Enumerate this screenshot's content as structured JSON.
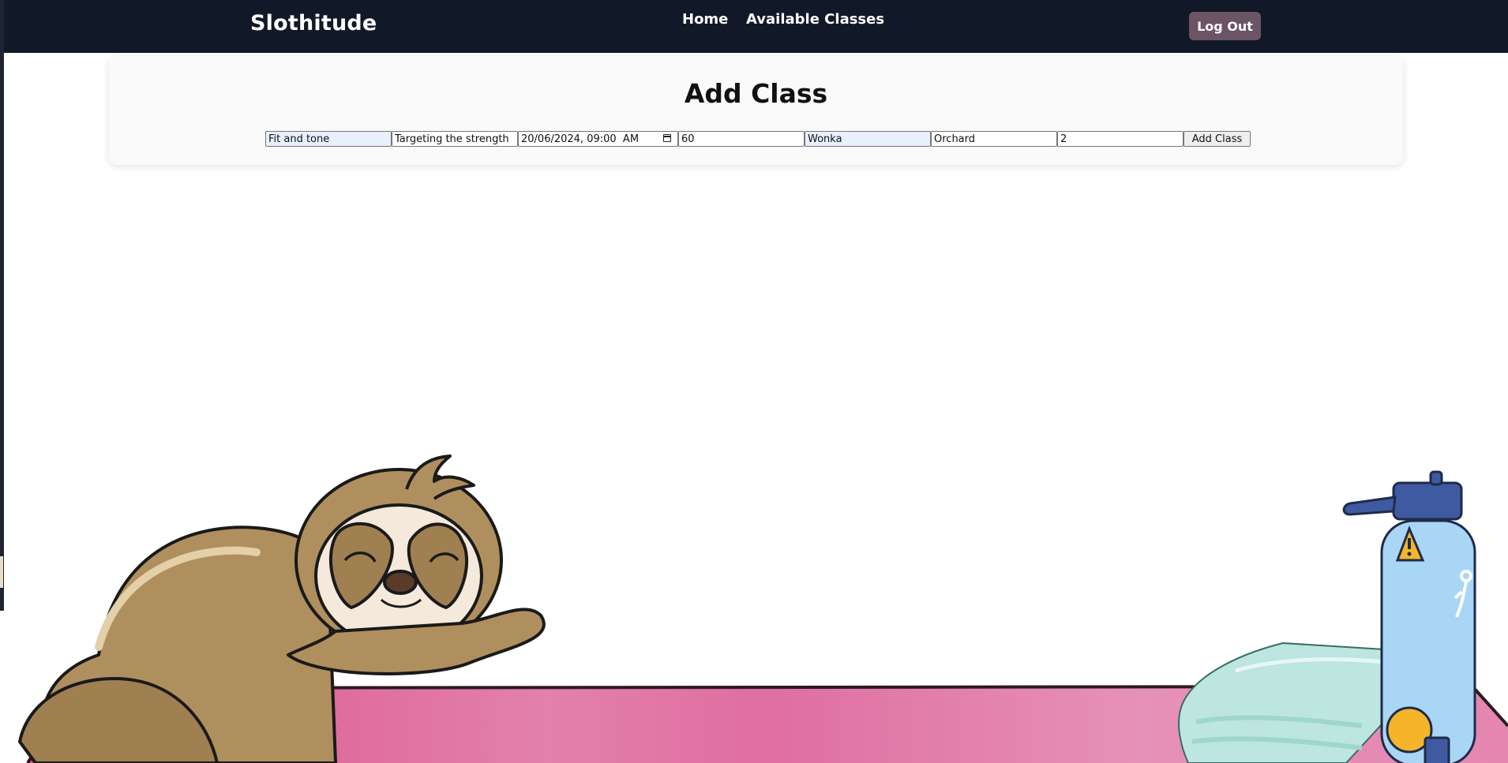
{
  "navbar": {
    "brand": "Slothitude",
    "links": [
      "Home",
      "Available Classes"
    ],
    "logout_label": "Log Out"
  },
  "card": {
    "title": "Add Class",
    "fields": {
      "name": "Fit and tone",
      "description": "Targeting the strength",
      "datetime": "20/06/2024, 09:00  AM",
      "duration": "60",
      "instructor": "Wonka",
      "location": "Orchard",
      "capacity": "2"
    },
    "submit_label": "Add Class"
  },
  "colors": {
    "navbar_bg": "#111827",
    "logout_bg": "#6b5464",
    "mat_pink": "#e384ad"
  },
  "illustration": {
    "icons": [
      "sleeping-sloth-icon",
      "yoga-mat-icon",
      "folded-towel-icon",
      "water-bottle-icon"
    ]
  }
}
